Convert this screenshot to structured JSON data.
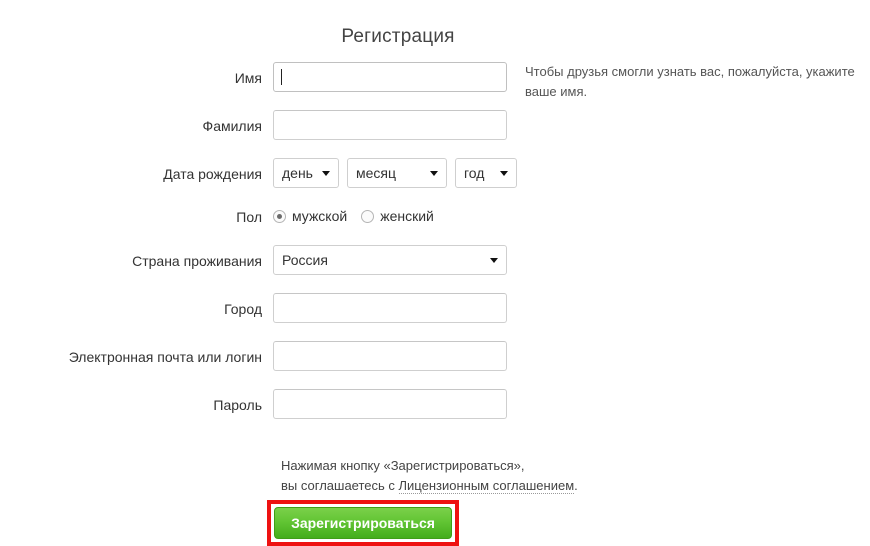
{
  "page": {
    "title": "Регистрация",
    "background_color": "#ffffff"
  },
  "form": {
    "fields": {
      "first_name": {
        "label": "Имя",
        "value": "",
        "placeholder": "",
        "focused": true,
        "hint": "Чтобы друзья смогли узнать вас, пожалуйста, укажите ваше имя."
      },
      "last_name": {
        "label": "Фамилия",
        "value": "",
        "placeholder": ""
      },
      "birth_date": {
        "label": "Дата рождения",
        "day": {
          "selected": "день"
        },
        "month": {
          "selected": "месяц"
        },
        "year": {
          "selected": "год"
        }
      },
      "gender": {
        "label": "Пол",
        "options": [
          {
            "label": "мужской",
            "checked": true
          },
          {
            "label": "женский",
            "checked": false
          }
        ]
      },
      "country": {
        "label": "Страна проживания",
        "selected": "Россия"
      },
      "city": {
        "label": "Город",
        "value": "",
        "placeholder": ""
      },
      "email": {
        "label": "Электронная почта или логин",
        "value": "",
        "placeholder": ""
      },
      "password": {
        "label": "Пароль",
        "value": "",
        "placeholder": ""
      }
    },
    "agreement": {
      "line1": "Нажимая кнопку «Зарегистрироваться»,",
      "line2_prefix": "вы соглашаетесь с ",
      "link_text": "Лицензионным соглашением",
      "line2_suffix": "."
    },
    "submit": {
      "label": "Зарегистрироваться",
      "color": "#55bd2a",
      "highlight_color": "#ee1111"
    }
  },
  "icons": {
    "dropdown_arrow": "chevron-down-icon"
  }
}
